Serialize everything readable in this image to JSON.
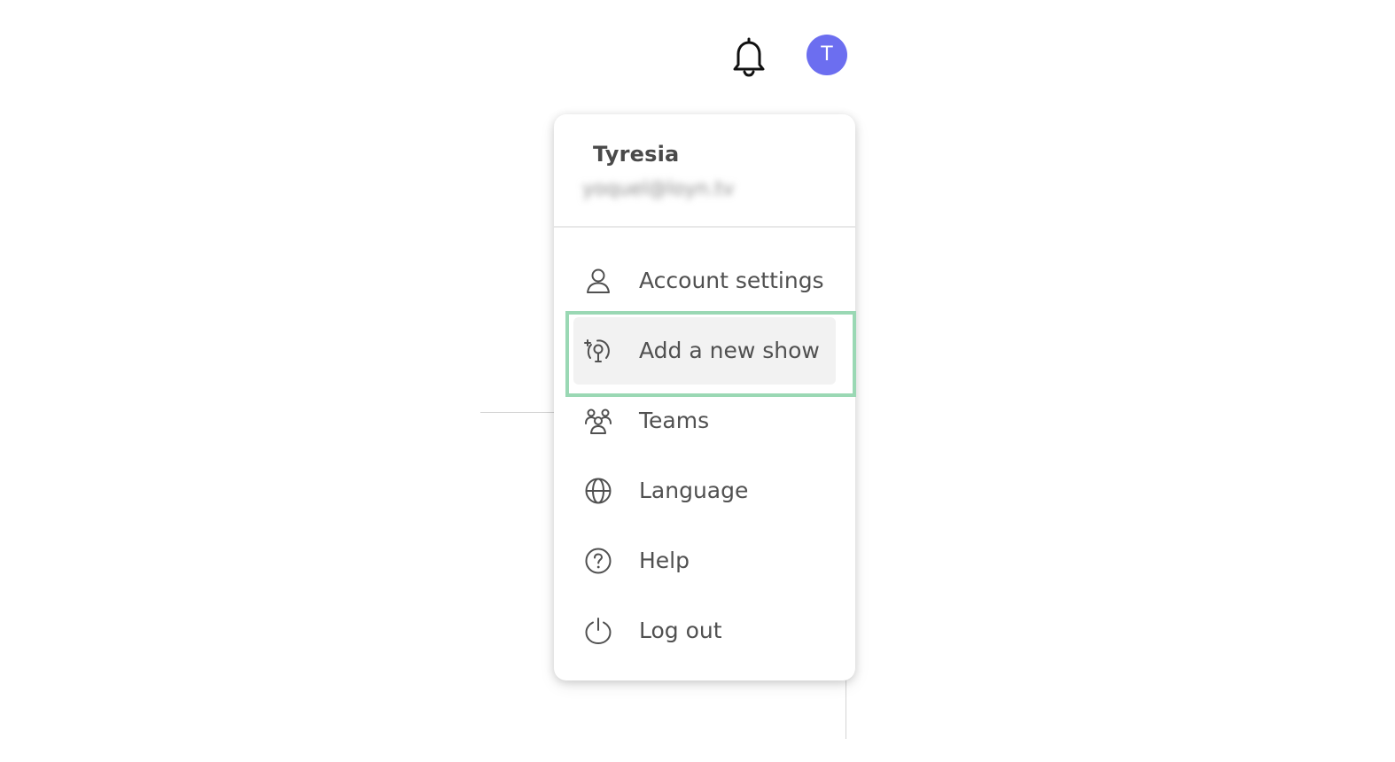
{
  "header": {
    "notification_icon": "bell-icon",
    "avatar_initial": "T",
    "avatar_color": "#6c6ef0"
  },
  "menu": {
    "user_name": "Tyresia",
    "user_email": "yoquel@loyn.tv",
    "items": [
      {
        "label": "Account settings",
        "icon": "user-icon"
      },
      {
        "label": "Add a new show",
        "icon": "podcast-add-icon"
      },
      {
        "label": "Teams",
        "icon": "team-icon"
      },
      {
        "label": "Language",
        "icon": "globe-icon"
      },
      {
        "label": "Help",
        "icon": "help-circle-icon"
      },
      {
        "label": "Log out",
        "icon": "power-icon"
      }
    ],
    "highlighted_item": "Add a new show",
    "highlight_color": "#9ad8b4"
  }
}
